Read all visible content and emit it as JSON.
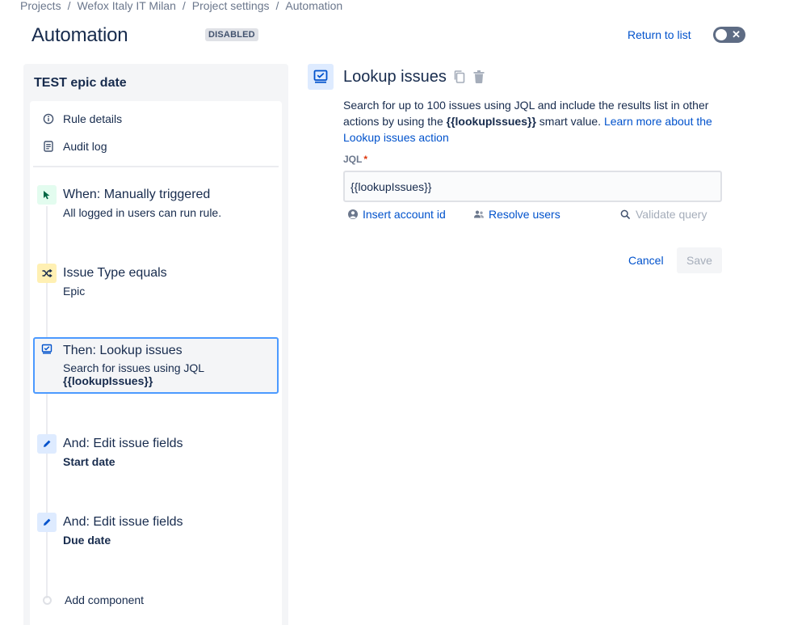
{
  "breadcrumb": [
    "Projects",
    "Wefox Italy IT Milan",
    "Project settings",
    "Automation"
  ],
  "header": {
    "title": "Automation",
    "status": "DISABLED",
    "return_label": "Return to list"
  },
  "rule": {
    "name": "TEST epic date",
    "meta": [
      {
        "label": "Rule details",
        "icon": "info-icon"
      },
      {
        "label": "Audit log",
        "icon": "document-icon"
      }
    ],
    "components": [
      {
        "title": "When: Manually triggered",
        "subtitle": "All logged in users can run rule.",
        "icon": "cursor-icon",
        "color": "#e3fcef"
      },
      {
        "title": "Issue Type equals",
        "subtitle": "Epic",
        "icon": "shuffle-icon",
        "color": "#fff0b3"
      },
      {
        "title": "Then: Lookup issues",
        "subtitle": "Search for issues using JQL",
        "subtitle2": "{{lookupIssues}}",
        "icon": "lookup-icon",
        "color": "#deebff"
      },
      {
        "title": "And: Edit issue fields",
        "subtitle": "Start date",
        "icon": "pencil-icon",
        "color": "#deebff"
      },
      {
        "title": "And: Edit issue fields",
        "subtitle": "Due date",
        "icon": "pencil-icon",
        "color": "#deebff"
      }
    ],
    "add_label": "Add component"
  },
  "detail": {
    "title": "Lookup issues",
    "desc_before": "Search for up to 100 issues using JQL and include the results list in other actions by using the ",
    "desc_smart": "{{lookupIssues}}",
    "desc_after": " smart value. ",
    "desc_link": "Learn more about the Lookup issues action",
    "jql_label": "JQL",
    "jql_required": "*",
    "jql_value": "{{lookupIssues}}",
    "actions": {
      "insert_account": "Insert account id",
      "resolve_users": "Resolve users",
      "validate_query": "Validate query"
    },
    "cancel_label": "Cancel",
    "save_label": "Save"
  },
  "colors": {
    "accent": "#0052cc",
    "selected_border": "#4c9aff",
    "required": "#de350b"
  }
}
